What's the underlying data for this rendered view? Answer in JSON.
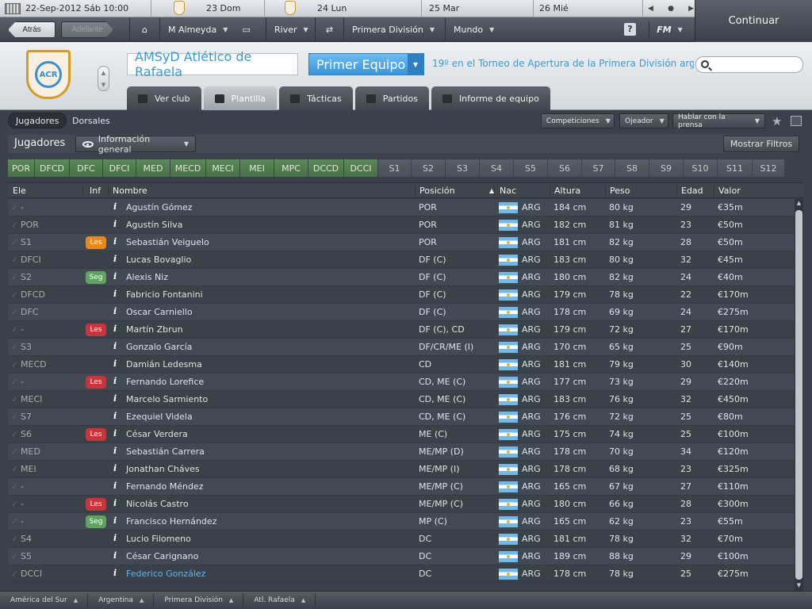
{
  "topbar": {
    "date": "22-Sep-2012 Sáb 10:00",
    "days": [
      "23 Dom",
      "24 Lun",
      "25 Mar",
      "26 Mié"
    ]
  },
  "nav": {
    "back": "Atrás",
    "forward": "Adelante",
    "manager": "M Almeyda",
    "rival": "River",
    "league": "Primera División",
    "world": "Mundo",
    "help": "?",
    "fm": "FM",
    "continue": "Continuar"
  },
  "club": {
    "name": "AMSyD Atlético de Rafaela",
    "team": "Primer Equipo",
    "league_pos": "19º en el Torneo de Apertura de la Primera División argentina"
  },
  "tabs": [
    "Ver club",
    "Plantilla",
    "Tácticas",
    "Partidos",
    "Informe de equipo"
  ],
  "subtabs": [
    "Jugadores",
    "Dorsales"
  ],
  "actions": [
    "Competiciones",
    "Ojeador",
    "Hablar con la prensa"
  ],
  "section": {
    "title": "Jugadores",
    "view": "Información general",
    "filters": "Mostrar Filtros"
  },
  "positions": [
    {
      "label": "POR",
      "active": true
    },
    {
      "label": "DFCD",
      "active": true
    },
    {
      "label": "DFC",
      "active": true
    },
    {
      "label": "DFCI",
      "active": true
    },
    {
      "label": "MED",
      "active": true
    },
    {
      "label": "MECD",
      "active": true
    },
    {
      "label": "MECI",
      "active": true
    },
    {
      "label": "MEI",
      "active": true
    },
    {
      "label": "MPC",
      "active": true
    },
    {
      "label": "DCCD",
      "active": true
    },
    {
      "label": "DCCI",
      "active": true
    },
    {
      "label": "S1",
      "active": false
    },
    {
      "label": "S2",
      "active": false
    },
    {
      "label": "S3",
      "active": false
    },
    {
      "label": "S4",
      "active": false
    },
    {
      "label": "S5",
      "active": false
    },
    {
      "label": "S6",
      "active": false
    },
    {
      "label": "S7",
      "active": false
    },
    {
      "label": "S8",
      "active": false
    },
    {
      "label": "S9",
      "active": false
    },
    {
      "label": "S10",
      "active": false
    },
    {
      "label": "S11",
      "active": false
    },
    {
      "label": "S12",
      "active": false
    }
  ],
  "columns": {
    "ele": "Ele",
    "inf": "Inf",
    "name": "Nombre",
    "position": "Posición",
    "nat": "Nac",
    "height": "Altura",
    "weight": "Peso",
    "age": "Edad",
    "value": "Valor"
  },
  "players": [
    {
      "ele": "-",
      "inf": "",
      "name": "Agustín Gómez",
      "pos": "POR",
      "nat": "ARG",
      "height": "184 cm",
      "weight": "80 kg",
      "age": "29",
      "value": "€35m"
    },
    {
      "ele": "POR",
      "inf": "",
      "name": "Agustín Silva",
      "pos": "POR",
      "nat": "ARG",
      "height": "182 cm",
      "weight": "81 kg",
      "age": "23",
      "value": "€50m"
    },
    {
      "ele": "S1",
      "inf": "Les",
      "inf_color": "#e58a1f",
      "name": "Sebastián Veiguelo",
      "pos": "POR",
      "nat": "ARG",
      "height": "181 cm",
      "weight": "82 kg",
      "age": "28",
      "value": "€50m"
    },
    {
      "ele": "DFCI",
      "inf": "",
      "name": "Lucas Bovaglio",
      "pos": "DF (C)",
      "nat": "ARG",
      "height": "183 cm",
      "weight": "80 kg",
      "age": "32",
      "value": "€45m"
    },
    {
      "ele": "S2",
      "inf": "Seg",
      "inf_color": "#5ea35f",
      "name": "Alexis Niz",
      "pos": "DF (C)",
      "nat": "ARG",
      "height": "180 cm",
      "weight": "82 kg",
      "age": "24",
      "value": "€40m"
    },
    {
      "ele": "DFCD",
      "inf": "",
      "name": "Fabricio Fontanini",
      "pos": "DF (C)",
      "nat": "ARG",
      "height": "179 cm",
      "weight": "78 kg",
      "age": "22",
      "value": "€170m"
    },
    {
      "ele": "DFC",
      "inf": "",
      "name": "Oscar Carniello",
      "pos": "DF (C)",
      "nat": "ARG",
      "height": "178 cm",
      "weight": "69 kg",
      "age": "24",
      "value": "€275m"
    },
    {
      "ele": "-",
      "inf": "Les",
      "inf_color": "#c7343a",
      "name": "Martín Zbrun",
      "pos": "DF (C), CD",
      "nat": "ARG",
      "height": "179 cm",
      "weight": "72 kg",
      "age": "27",
      "value": "€170m"
    },
    {
      "ele": "S3",
      "inf": "",
      "name": "Gonzalo García",
      "pos": "DF/CR/ME (I)",
      "nat": "ARG",
      "height": "170 cm",
      "weight": "65 kg",
      "age": "25",
      "value": "€90m"
    },
    {
      "ele": "MECD",
      "inf": "",
      "name": "Damián Ledesma",
      "pos": "CD",
      "nat": "ARG",
      "height": "181 cm",
      "weight": "79 kg",
      "age": "30",
      "value": "€140m"
    },
    {
      "ele": "-",
      "inf": "Les",
      "inf_color": "#c7343a",
      "name": "Fernando Lorefice",
      "pos": "CD, ME (C)",
      "nat": "ARG",
      "height": "177 cm",
      "weight": "73 kg",
      "age": "29",
      "value": "€220m"
    },
    {
      "ele": "MECI",
      "inf": "",
      "name": "Marcelo Sarmiento",
      "pos": "CD, ME (C)",
      "nat": "ARG",
      "height": "183 cm",
      "weight": "76 kg",
      "age": "32",
      "value": "€450m"
    },
    {
      "ele": "S7",
      "inf": "",
      "name": "Ezequiel Videla",
      "pos": "CD, ME (C)",
      "nat": "ARG",
      "height": "176 cm",
      "weight": "72 kg",
      "age": "25",
      "value": "€80m"
    },
    {
      "ele": "S6",
      "inf": "Les",
      "inf_color": "#c7343a",
      "name": "César Verdera",
      "pos": "ME (C)",
      "nat": "ARG",
      "height": "175 cm",
      "weight": "74 kg",
      "age": "25",
      "value": "€100m"
    },
    {
      "ele": "MED",
      "inf": "",
      "name": "Sebastián Carrera",
      "pos": "ME/MP (D)",
      "nat": "ARG",
      "height": "178 cm",
      "weight": "70 kg",
      "age": "34",
      "value": "€120m"
    },
    {
      "ele": "MEI",
      "inf": "",
      "name": "Jonathan Cháves",
      "pos": "ME/MP (I)",
      "nat": "ARG",
      "height": "178 cm",
      "weight": "68 kg",
      "age": "23",
      "value": "€325m"
    },
    {
      "ele": "-",
      "inf": "",
      "name": "Fernando Méndez",
      "pos": "ME/MP (C)",
      "nat": "ARG",
      "height": "165 cm",
      "weight": "67 kg",
      "age": "27",
      "value": "€110m"
    },
    {
      "ele": "-",
      "inf": "Les",
      "inf_color": "#c7343a",
      "name": "Nicolás Castro",
      "pos": "ME/MP (C)",
      "nat": "ARG",
      "height": "180 cm",
      "weight": "66 kg",
      "age": "28",
      "value": "€300m"
    },
    {
      "ele": "-",
      "inf": "Seg",
      "inf_color": "#5ea35f",
      "name": "Francisco Hernández",
      "pos": "MP (C)",
      "nat": "ARG",
      "height": "165 cm",
      "weight": "62 kg",
      "age": "23",
      "value": "€55m"
    },
    {
      "ele": "S4",
      "inf": "",
      "name": "Lucio Filomeno",
      "pos": "DC",
      "nat": "ARG",
      "height": "181 cm",
      "weight": "78 kg",
      "age": "32",
      "value": "€70m"
    },
    {
      "ele": "S5",
      "inf": "",
      "name": "César Carignano",
      "pos": "DC",
      "nat": "ARG",
      "height": "189 cm",
      "weight": "88 kg",
      "age": "29",
      "value": "€100m"
    },
    {
      "ele": "DCCI",
      "inf": "",
      "name": "Federico González",
      "pos": "DC",
      "nat": "ARG",
      "height": "178 cm",
      "weight": "78 kg",
      "age": "25",
      "value": "€275m",
      "highlight": true
    }
  ],
  "bottombar": [
    "América del Sur",
    "Argentina",
    "Primera División",
    "Atl. Rafaela"
  ],
  "colors": {
    "accent": "#3a9ad6",
    "green": "#5ea35f",
    "orange": "#e58a1f",
    "red": "#c7343a"
  }
}
